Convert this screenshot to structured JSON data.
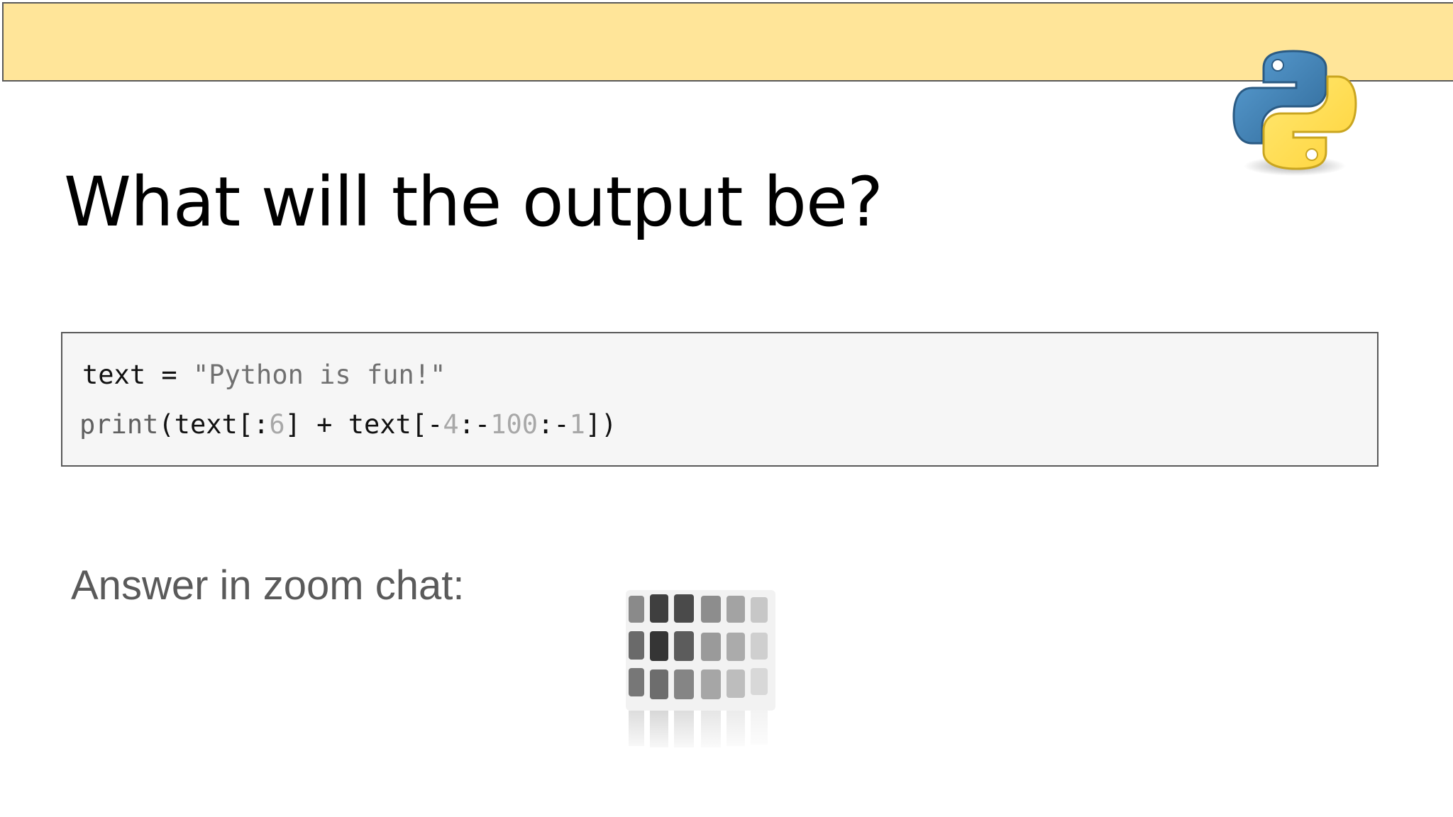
{
  "slide": {
    "title": "What will the output be?",
    "answer_label": "Answer in zoom chat:"
  },
  "code": {
    "line1": {
      "var": "text",
      "op": " = ",
      "string": "\"Python is fun!\""
    },
    "line2": {
      "func": "print",
      "p1": "(text[:",
      "n1": "6",
      "p2": "] + text[-",
      "n2": "4",
      "p3": ":-",
      "n3": "100",
      "p4": ":-",
      "n4": "1",
      "p5": "])"
    }
  },
  "icons": {
    "logo": "python-logo-icon",
    "cube": "rubiks-cube-icon"
  },
  "colors": {
    "banner": "#ffe599",
    "banner_border": "#595959",
    "code_background": "#f6f6f6",
    "python_blue": "#3a72a6",
    "python_yellow": "#f6d33c"
  }
}
